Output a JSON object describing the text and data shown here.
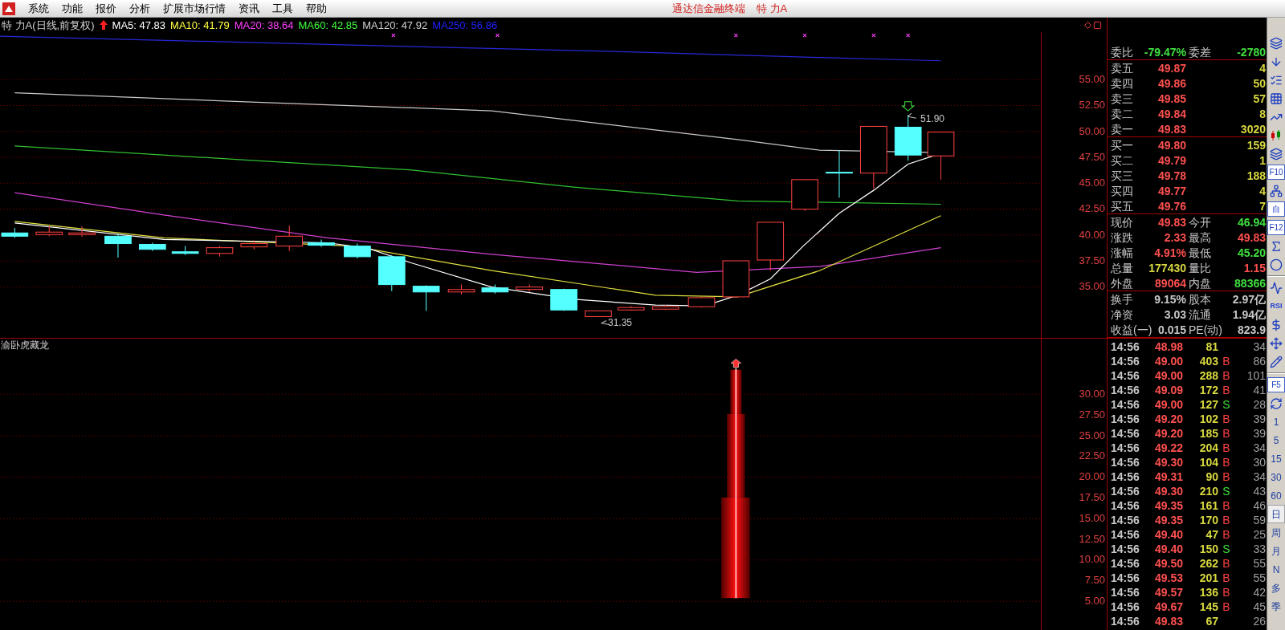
{
  "menu_bar": {
    "items": [
      "系统",
      "功能",
      "报价",
      "分析",
      "扩展市场行情",
      "资讯",
      "工具",
      "帮助"
    ],
    "title": "通达信金融终端",
    "stock": "特 力A"
  },
  "chart_header": {
    "title": "特 力A(日线,前复权)",
    "indicators": [
      {
        "label": "MA5: 47.83",
        "color": "#ffffff"
      },
      {
        "label": "MA10: 41.79",
        "color": "#ffff40"
      },
      {
        "label": "MA20: 38.64",
        "color": "#ff40ff"
      },
      {
        "label": "MA60: 42.85",
        "color": "#40ff40"
      },
      {
        "label": "MA120: 47.92",
        "color": "#d0d0d0"
      },
      {
        "label": "MA250: 56.86",
        "color": "#2020ff"
      }
    ]
  },
  "price_chart": {
    "high_label": "51.90",
    "low_label": "31.35",
    "ticks": [
      "55.00",
      "52.50",
      "50.00",
      "47.50",
      "45.00",
      "42.50",
      "40.00",
      "37.50",
      "35.00"
    ]
  },
  "indicator_panel": {
    "title": "渝卧虎藏龙",
    "ticks": [
      "30.00",
      "27.50",
      "25.00",
      "22.50",
      "20.00",
      "17.50",
      "15.00",
      "12.50",
      "10.00",
      "7.50",
      "5.00"
    ]
  },
  "quote": {
    "ratio": {
      "label": "委比",
      "value": "-79.47%",
      "diff_label": "委差",
      "diff": "-2780"
    },
    "sell": [
      {
        "label": "卖五",
        "price": "49.87",
        "volume": "4"
      },
      {
        "label": "卖四",
        "price": "49.86",
        "volume": "50"
      },
      {
        "label": "卖三",
        "price": "49.85",
        "volume": "57"
      },
      {
        "label": "卖二",
        "price": "49.84",
        "volume": "8"
      },
      {
        "label": "卖一",
        "price": "49.83",
        "volume": "3020"
      }
    ],
    "buy": [
      {
        "label": "买一",
        "price": "49.80",
        "volume": "159"
      },
      {
        "label": "买二",
        "price": "49.79",
        "volume": "1"
      },
      {
        "label": "买三",
        "price": "49.78",
        "volume": "188"
      },
      {
        "label": "买四",
        "price": "49.77",
        "volume": "4"
      },
      {
        "label": "买五",
        "price": "49.76",
        "volume": "7"
      }
    ],
    "stats": [
      {
        "cells": [
          {
            "label": "现价",
            "value": "49.83",
            "color": "#ff5050"
          },
          {
            "label": "今开",
            "value": "46.94",
            "color": "#40e040"
          }
        ]
      },
      {
        "cells": [
          {
            "label": "涨跌",
            "value": "2.33",
            "color": "#ff5050"
          },
          {
            "label": "最高",
            "value": "49.83",
            "color": "#ff5050"
          }
        ]
      },
      {
        "cells": [
          {
            "label": "涨幅",
            "value": "4.91%",
            "color": "#ff5050"
          },
          {
            "label": "最低",
            "value": "45.20",
            "color": "#40e040"
          }
        ]
      },
      {
        "cells": [
          {
            "label": "总量",
            "value": "177430",
            "color": "#d8d840"
          },
          {
            "label": "量比",
            "value": "1.15",
            "color": "#ff5050"
          }
        ]
      },
      {
        "cells": [
          {
            "label": "外盘",
            "value": "89064",
            "color": "#ff5050"
          },
          {
            "label": "内盘",
            "value": "88366",
            "color": "#40e040"
          }
        ]
      }
    ],
    "finance": [
      {
        "label": "换手",
        "value": "9.15%",
        "label2": "股本",
        "value2": "2.97亿"
      },
      {
        "label": "净资",
        "value": "3.03",
        "label2": "流通",
        "value2": "1.94亿"
      },
      {
        "label": "收益(一)",
        "value": "0.015",
        "label2": "PE(动)",
        "value2": "823.9"
      }
    ]
  },
  "trades": [
    {
      "time": "14:56",
      "price": "48.98",
      "volume": "81",
      "kind": "none",
      "count": "34"
    },
    {
      "time": "14:56",
      "price": "49.00",
      "volume": "403",
      "kind": "buy",
      "side": "B",
      "count": "86"
    },
    {
      "time": "14:56",
      "price": "49.00",
      "volume": "288",
      "kind": "buy",
      "side": "B",
      "count": "101"
    },
    {
      "time": "14:56",
      "price": "49.09",
      "volume": "172",
      "kind": "buy",
      "side": "B",
      "count": "41"
    },
    {
      "time": "14:56",
      "price": "49.00",
      "volume": "127",
      "kind": "sell",
      "side": "S",
      "count": "28"
    },
    {
      "time": "14:56",
      "price": "49.20",
      "volume": "102",
      "kind": "buy",
      "side": "B",
      "count": "39"
    },
    {
      "time": "14:56",
      "price": "49.20",
      "volume": "185",
      "kind": "buy",
      "side": "B",
      "count": "39"
    },
    {
      "time": "14:56",
      "price": "49.22",
      "volume": "204",
      "kind": "buy",
      "side": "B",
      "count": "34"
    },
    {
      "time": "14:56",
      "price": "49.30",
      "volume": "104",
      "kind": "buy",
      "side": "B",
      "count": "30"
    },
    {
      "time": "14:56",
      "price": "49.31",
      "volume": "90",
      "kind": "buy",
      "side": "B",
      "count": "34"
    },
    {
      "time": "14:56",
      "price": "49.30",
      "volume": "210",
      "kind": "sell",
      "side": "S",
      "count": "43"
    },
    {
      "time": "14:56",
      "price": "49.35",
      "volume": "161",
      "kind": "buy",
      "side": "B",
      "count": "46"
    },
    {
      "time": "14:56",
      "price": "49.35",
      "volume": "170",
      "kind": "buy",
      "side": "B",
      "count": "59"
    },
    {
      "time": "14:56",
      "price": "49.40",
      "volume": "47",
      "kind": "buy",
      "side": "B",
      "count": "25"
    },
    {
      "time": "14:56",
      "price": "49.40",
      "volume": "150",
      "kind": "sell",
      "side": "S",
      "count": "33"
    },
    {
      "time": "14:56",
      "price": "49.50",
      "volume": "262",
      "kind": "buy",
      "side": "B",
      "count": "55"
    },
    {
      "time": "14:56",
      "price": "49.53",
      "volume": "201",
      "kind": "buy",
      "side": "B",
      "count": "55"
    },
    {
      "time": "14:56",
      "price": "49.57",
      "volume": "136",
      "kind": "buy",
      "side": "B",
      "count": "42"
    },
    {
      "time": "14:56",
      "price": "49.67",
      "volume": "145",
      "kind": "buy",
      "side": "B",
      "count": "45"
    },
    {
      "time": "14:56",
      "price": "49.83",
      "volume": "67",
      "kind": "none",
      "count": "26"
    }
  ],
  "toolbar": [
    {
      "kind": "icon"
    },
    {
      "kind": "icon"
    },
    {
      "kind": "icon"
    },
    {
      "kind": "icon"
    },
    {
      "kind": "icon"
    },
    {
      "kind": "icon"
    },
    {
      "kind": "icon"
    },
    {
      "kind": "boxed",
      "label": "F10"
    },
    {
      "kind": "icon"
    },
    {
      "kind": "boxed",
      "label": "自"
    },
    {
      "kind": "boxed",
      "label": "F12"
    },
    {
      "kind": "icon"
    },
    {
      "kind": "icon"
    },
    {
      "kind": "separator"
    },
    {
      "kind": "icon"
    },
    {
      "kind": "text",
      "label": "RSI"
    },
    {
      "kind": "icon"
    },
    {
      "kind": "icon"
    },
    {
      "kind": "icon"
    },
    {
      "kind": "separator"
    },
    {
      "kind": "boxed",
      "label": "F5"
    },
    {
      "kind": "icon"
    },
    {
      "kind": "period",
      "label": "1",
      "selected": false
    },
    {
      "kind": "period",
      "label": "5",
      "selected": false
    },
    {
      "kind": "period",
      "label": "15",
      "selected": false
    },
    {
      "kind": "period",
      "label": "30",
      "selected": false
    },
    {
      "kind": "period",
      "label": "60",
      "selected": false
    },
    {
      "kind": "period",
      "label": "日",
      "selected": true
    },
    {
      "kind": "period",
      "label": "周",
      "selected": false
    },
    {
      "kind": "period",
      "label": "月",
      "selected": false
    },
    {
      "kind": "period",
      "label": "N",
      "selected": false
    },
    {
      "kind": "period",
      "label": "多",
      "selected": false
    },
    {
      "kind": "period",
      "label": "季",
      "selected": false
    }
  ]
}
